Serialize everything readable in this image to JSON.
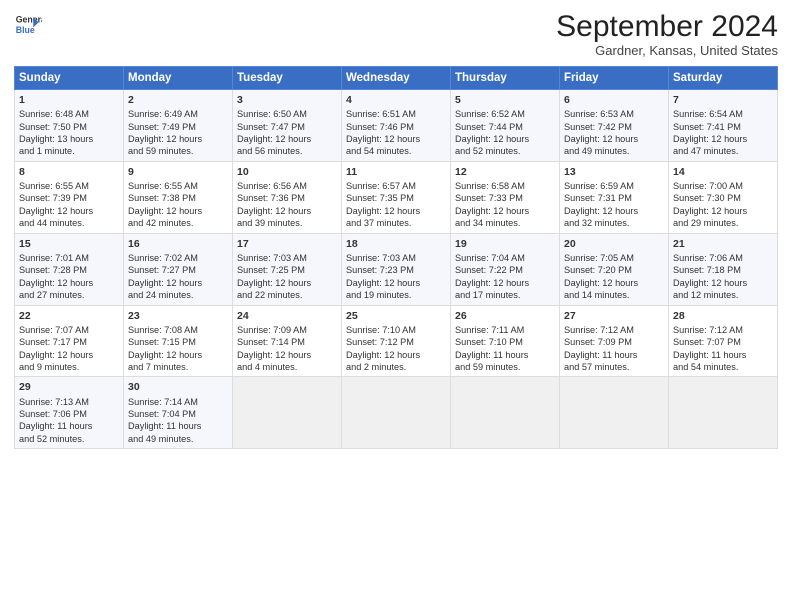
{
  "header": {
    "logo_line1": "General",
    "logo_line2": "Blue",
    "month": "September 2024",
    "location": "Gardner, Kansas, United States"
  },
  "days_of_week": [
    "Sunday",
    "Monday",
    "Tuesday",
    "Wednesday",
    "Thursday",
    "Friday",
    "Saturday"
  ],
  "weeks": [
    [
      {
        "day": "1",
        "lines": [
          "Sunrise: 6:48 AM",
          "Sunset: 7:50 PM",
          "Daylight: 13 hours",
          "and 1 minute."
        ]
      },
      {
        "day": "2",
        "lines": [
          "Sunrise: 6:49 AM",
          "Sunset: 7:49 PM",
          "Daylight: 12 hours",
          "and 59 minutes."
        ]
      },
      {
        "day": "3",
        "lines": [
          "Sunrise: 6:50 AM",
          "Sunset: 7:47 PM",
          "Daylight: 12 hours",
          "and 56 minutes."
        ]
      },
      {
        "day": "4",
        "lines": [
          "Sunrise: 6:51 AM",
          "Sunset: 7:46 PM",
          "Daylight: 12 hours",
          "and 54 minutes."
        ]
      },
      {
        "day": "5",
        "lines": [
          "Sunrise: 6:52 AM",
          "Sunset: 7:44 PM",
          "Daylight: 12 hours",
          "and 52 minutes."
        ]
      },
      {
        "day": "6",
        "lines": [
          "Sunrise: 6:53 AM",
          "Sunset: 7:42 PM",
          "Daylight: 12 hours",
          "and 49 minutes."
        ]
      },
      {
        "day": "7",
        "lines": [
          "Sunrise: 6:54 AM",
          "Sunset: 7:41 PM",
          "Daylight: 12 hours",
          "and 47 minutes."
        ]
      }
    ],
    [
      {
        "day": "8",
        "lines": [
          "Sunrise: 6:55 AM",
          "Sunset: 7:39 PM",
          "Daylight: 12 hours",
          "and 44 minutes."
        ]
      },
      {
        "day": "9",
        "lines": [
          "Sunrise: 6:55 AM",
          "Sunset: 7:38 PM",
          "Daylight: 12 hours",
          "and 42 minutes."
        ]
      },
      {
        "day": "10",
        "lines": [
          "Sunrise: 6:56 AM",
          "Sunset: 7:36 PM",
          "Daylight: 12 hours",
          "and 39 minutes."
        ]
      },
      {
        "day": "11",
        "lines": [
          "Sunrise: 6:57 AM",
          "Sunset: 7:35 PM",
          "Daylight: 12 hours",
          "and 37 minutes."
        ]
      },
      {
        "day": "12",
        "lines": [
          "Sunrise: 6:58 AM",
          "Sunset: 7:33 PM",
          "Daylight: 12 hours",
          "and 34 minutes."
        ]
      },
      {
        "day": "13",
        "lines": [
          "Sunrise: 6:59 AM",
          "Sunset: 7:31 PM",
          "Daylight: 12 hours",
          "and 32 minutes."
        ]
      },
      {
        "day": "14",
        "lines": [
          "Sunrise: 7:00 AM",
          "Sunset: 7:30 PM",
          "Daylight: 12 hours",
          "and 29 minutes."
        ]
      }
    ],
    [
      {
        "day": "15",
        "lines": [
          "Sunrise: 7:01 AM",
          "Sunset: 7:28 PM",
          "Daylight: 12 hours",
          "and 27 minutes."
        ]
      },
      {
        "day": "16",
        "lines": [
          "Sunrise: 7:02 AM",
          "Sunset: 7:27 PM",
          "Daylight: 12 hours",
          "and 24 minutes."
        ]
      },
      {
        "day": "17",
        "lines": [
          "Sunrise: 7:03 AM",
          "Sunset: 7:25 PM",
          "Daylight: 12 hours",
          "and 22 minutes."
        ]
      },
      {
        "day": "18",
        "lines": [
          "Sunrise: 7:03 AM",
          "Sunset: 7:23 PM",
          "Daylight: 12 hours",
          "and 19 minutes."
        ]
      },
      {
        "day": "19",
        "lines": [
          "Sunrise: 7:04 AM",
          "Sunset: 7:22 PM",
          "Daylight: 12 hours",
          "and 17 minutes."
        ]
      },
      {
        "day": "20",
        "lines": [
          "Sunrise: 7:05 AM",
          "Sunset: 7:20 PM",
          "Daylight: 12 hours",
          "and 14 minutes."
        ]
      },
      {
        "day": "21",
        "lines": [
          "Sunrise: 7:06 AM",
          "Sunset: 7:18 PM",
          "Daylight: 12 hours",
          "and 12 minutes."
        ]
      }
    ],
    [
      {
        "day": "22",
        "lines": [
          "Sunrise: 7:07 AM",
          "Sunset: 7:17 PM",
          "Daylight: 12 hours",
          "and 9 minutes."
        ]
      },
      {
        "day": "23",
        "lines": [
          "Sunrise: 7:08 AM",
          "Sunset: 7:15 PM",
          "Daylight: 12 hours",
          "and 7 minutes."
        ]
      },
      {
        "day": "24",
        "lines": [
          "Sunrise: 7:09 AM",
          "Sunset: 7:14 PM",
          "Daylight: 12 hours",
          "and 4 minutes."
        ]
      },
      {
        "day": "25",
        "lines": [
          "Sunrise: 7:10 AM",
          "Sunset: 7:12 PM",
          "Daylight: 12 hours",
          "and 2 minutes."
        ]
      },
      {
        "day": "26",
        "lines": [
          "Sunrise: 7:11 AM",
          "Sunset: 7:10 PM",
          "Daylight: 11 hours",
          "and 59 minutes."
        ]
      },
      {
        "day": "27",
        "lines": [
          "Sunrise: 7:12 AM",
          "Sunset: 7:09 PM",
          "Daylight: 11 hours",
          "and 57 minutes."
        ]
      },
      {
        "day": "28",
        "lines": [
          "Sunrise: 7:12 AM",
          "Sunset: 7:07 PM",
          "Daylight: 11 hours",
          "and 54 minutes."
        ]
      }
    ],
    [
      {
        "day": "29",
        "lines": [
          "Sunrise: 7:13 AM",
          "Sunset: 7:06 PM",
          "Daylight: 11 hours",
          "and 52 minutes."
        ]
      },
      {
        "day": "30",
        "lines": [
          "Sunrise: 7:14 AM",
          "Sunset: 7:04 PM",
          "Daylight: 11 hours",
          "and 49 minutes."
        ]
      },
      {
        "day": "",
        "lines": []
      },
      {
        "day": "",
        "lines": []
      },
      {
        "day": "",
        "lines": []
      },
      {
        "day": "",
        "lines": []
      },
      {
        "day": "",
        "lines": []
      }
    ]
  ]
}
